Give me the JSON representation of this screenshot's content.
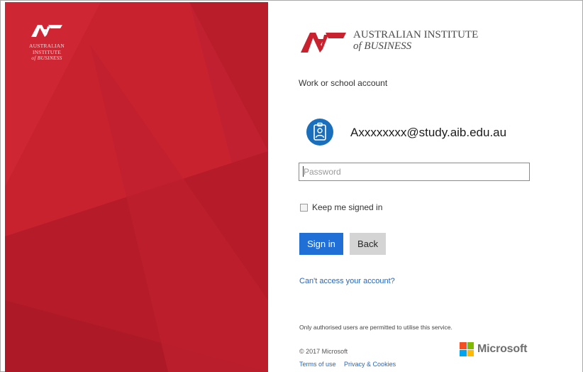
{
  "brand": {
    "panel_logo_lines": [
      "AUSTRALIAN",
      "INSTITUTE",
      "of BUSINESS"
    ],
    "name_line1": "AUSTRALIAN INSTITUTE",
    "name_line2": "of BUSINESS"
  },
  "account": {
    "type_label": "Work or school account",
    "email": "Axxxxxxxx@study.aib.edu.au",
    "avatar_icon": "id-badge-icon"
  },
  "form": {
    "password_placeholder": "Password",
    "keep_signed_in_label": "Keep me signed in",
    "keep_signed_in_checked": false,
    "signin_label": "Sign in",
    "back_label": "Back"
  },
  "links": {
    "cant_access": "Can't access your account?",
    "terms": "Terms of use",
    "privacy": "Privacy & Cookies"
  },
  "footer": {
    "notice": "Only authorised users are permitted to utilise this service.",
    "copyright": "© 2017 Microsoft",
    "ms_brand": "Microsoft"
  },
  "colors": {
    "brand_red": "#c8222f",
    "primary_button": "#1f6fd6",
    "secondary_button": "#d4d4d4",
    "link": "#2566c4",
    "avatar_blue": "#1a6fbd",
    "ms_red": "#f25022",
    "ms_green": "#7fba00",
    "ms_blue": "#00a4ef",
    "ms_yellow": "#ffb900"
  }
}
